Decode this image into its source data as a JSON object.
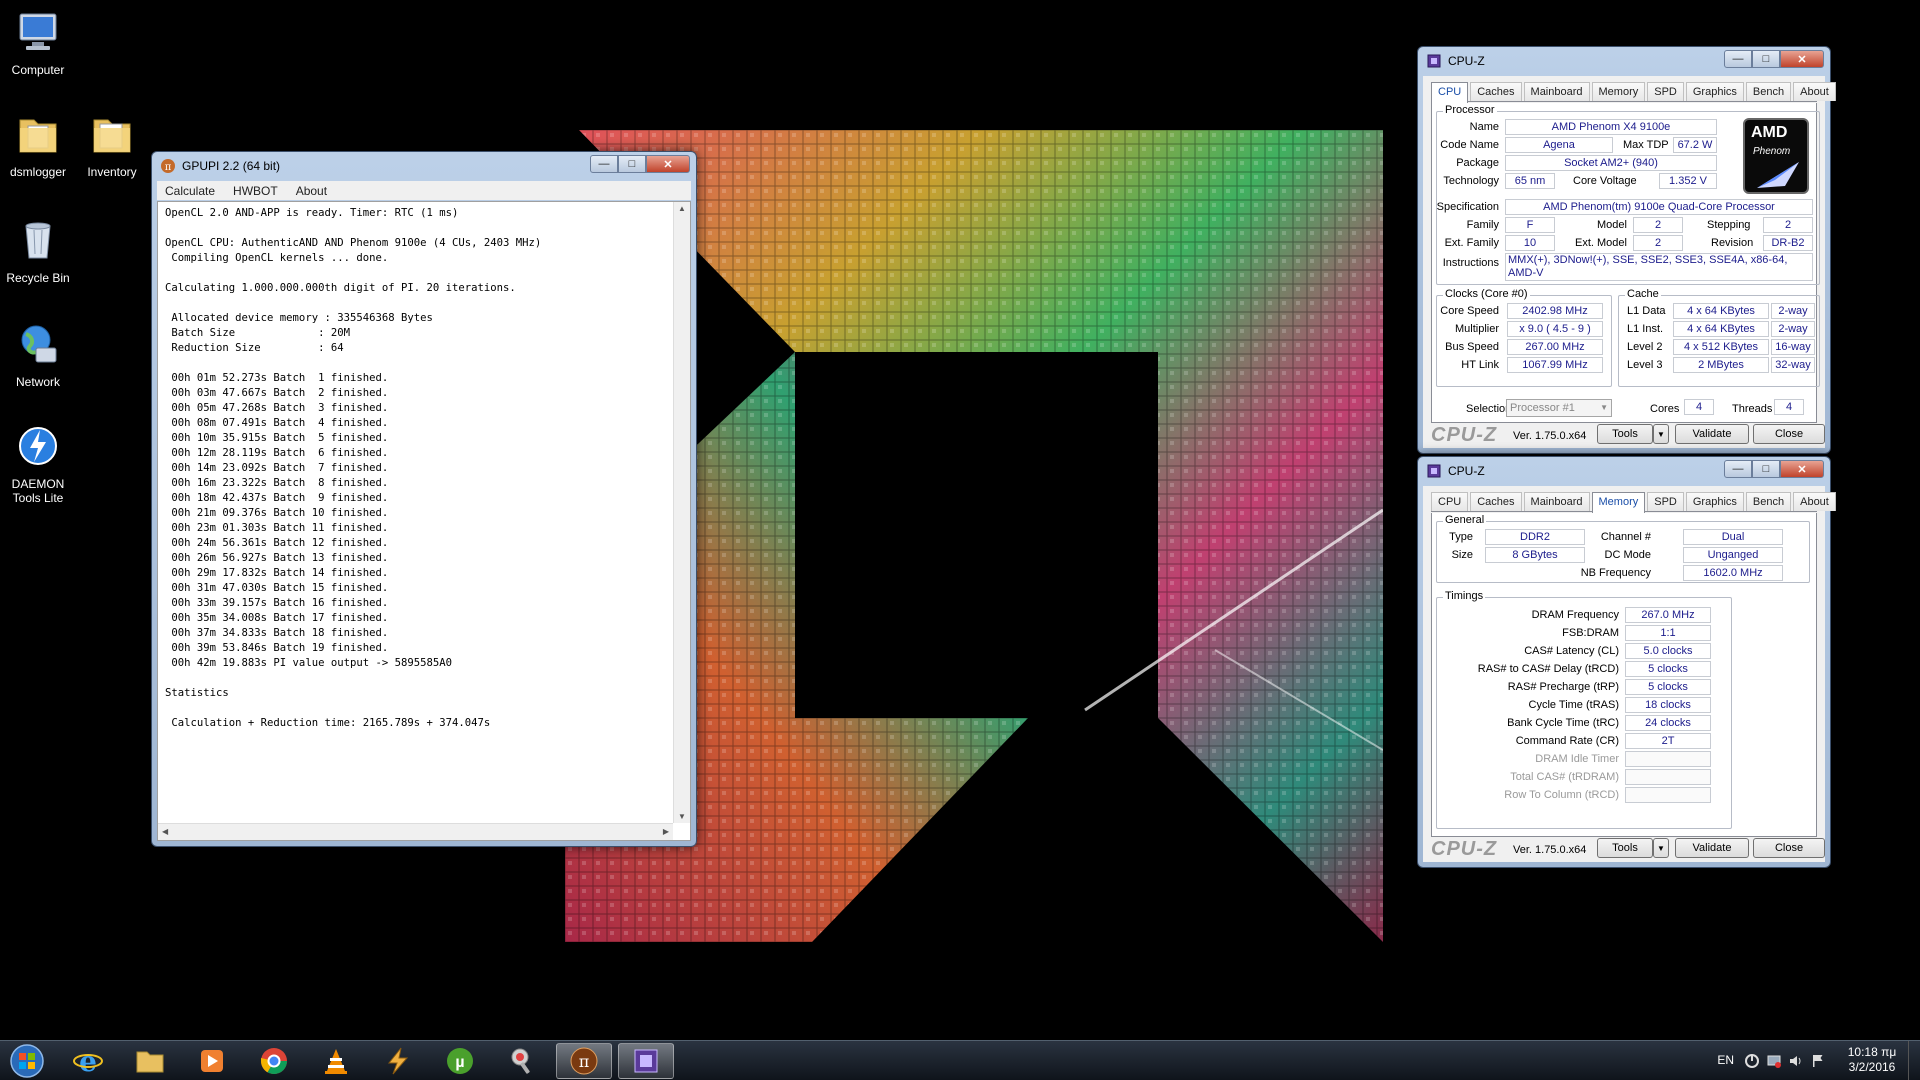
{
  "desktop": {
    "icons": [
      {
        "label": "Computer"
      },
      {
        "label": "dsmlogger"
      },
      {
        "label": "Inventory"
      },
      {
        "label": "Recycle Bin"
      },
      {
        "label": "Network"
      },
      {
        "label": "DAEMON Tools Lite"
      }
    ]
  },
  "gpupi": {
    "title": "GPUPI 2.2 (64 bit)",
    "menu": [
      "Calculate",
      "HWBOT",
      "About"
    ],
    "output": "OpenCL 2.0 AND-APP is ready. Timer: RTC (1 ms)\n\nOpenCL CPU: AuthenticAND AND Phenom 9100e (4 CUs, 2403 MHz)\n Compiling OpenCL kernels ... done.\n\nCalculating 1.000.000.000th digit of PI. 20 iterations.\n\n Allocated device memory : 335546368 Bytes\n Batch Size             : 20M\n Reduction Size         : 64\n\n 00h 01m 52.273s Batch  1 finished.\n 00h 03m 47.667s Batch  2 finished.\n 00h 05m 47.268s Batch  3 finished.\n 00h 08m 07.491s Batch  4 finished.\n 00h 10m 35.915s Batch  5 finished.\n 00h 12m 28.119s Batch  6 finished.\n 00h 14m 23.092s Batch  7 finished.\n 00h 16m 23.322s Batch  8 finished.\n 00h 18m 42.437s Batch  9 finished.\n 00h 21m 09.376s Batch 10 finished.\n 00h 23m 01.303s Batch 11 finished.\n 00h 24m 56.361s Batch 12 finished.\n 00h 26m 56.927s Batch 13 finished.\n 00h 29m 17.832s Batch 14 finished.\n 00h 31m 47.030s Batch 15 finished.\n 00h 33m 39.157s Batch 16 finished.\n 00h 35m 34.008s Batch 17 finished.\n 00h 37m 34.833s Batch 18 finished.\n 00h 39m 53.846s Batch 19 finished.\n 00h 42m 19.883s PI value output -> 5895585A0\n\nStatistics\n\n Calculation + Reduction time: 2165.789s + 374.047s"
  },
  "cpuz_common": {
    "title": "CPU-Z",
    "tabs": [
      "CPU",
      "Caches",
      "Mainboard",
      "Memory",
      "SPD",
      "Graphics",
      "Bench",
      "About"
    ],
    "brand": "CPU-Z",
    "version": "Ver. 1.75.0.x64",
    "tools_label": "Tools",
    "validate_label": "Validate",
    "close_label": "Close"
  },
  "cpuz_cpu": {
    "processor_group": "Processor",
    "labels": {
      "name": "Name",
      "code_name": "Code Name",
      "max_tdp": "Max TDP",
      "package": "Package",
      "technology": "Technology",
      "core_voltage": "Core Voltage",
      "specification": "Specification",
      "family": "Family",
      "model": "Model",
      "stepping": "Stepping",
      "ext_family": "Ext. Family",
      "ext_model": "Ext. Model",
      "revision": "Revision",
      "instructions": "Instructions"
    },
    "name": "AMD Phenom X4 9100e",
    "code_name": "Agena",
    "max_tdp": "67.2 W",
    "package": "Socket AM2+ (940)",
    "technology": "65 nm",
    "core_voltage": "1.352 V",
    "specification": "AMD Phenom(tm) 9100e Quad-Core Processor",
    "family": "F",
    "model": "2",
    "stepping": "2",
    "ext_family": "10",
    "ext_model": "2",
    "revision": "DR-B2",
    "instructions_line1": "MMX(+), 3DNow!(+), SSE, SSE2, SSE3, SSE4A, x86-64,",
    "instructions_line2": "AMD-V",
    "badge_amd": "AMD",
    "badge_phenom": "Phenom",
    "clocks_group": "Clocks (Core #0)",
    "clock_labels": {
      "core_speed": "Core Speed",
      "multiplier": "Multiplier",
      "bus_speed": "Bus Speed",
      "ht_link": "HT Link"
    },
    "core_speed": "2402.98 MHz",
    "multiplier": "x 9.0 ( 4.5 - 9 )",
    "bus_speed": "267.00 MHz",
    "ht_link": "1067.99 MHz",
    "cache_group": "Cache",
    "cache_rows": [
      {
        "label": "L1 Data",
        "size": "4 x 64 KBytes",
        "way": "2-way"
      },
      {
        "label": "L1 Inst.",
        "size": "4 x 64 KBytes",
        "way": "2-way"
      },
      {
        "label": "Level 2",
        "size": "4 x 512 KBytes",
        "way": "16-way"
      },
      {
        "label": "Level 3",
        "size": "2 MBytes",
        "way": "32-way"
      }
    ],
    "selection_label": "Selection",
    "selection_value": "Processor #1",
    "cores_label": "Cores",
    "cores": "4",
    "threads_label": "Threads",
    "threads": "4"
  },
  "cpuz_mem": {
    "general_group": "General",
    "type_label": "Type",
    "type": "DDR2",
    "size_label": "Size",
    "size": "8 GBytes",
    "channel_label": "Channel #",
    "channel": "Dual",
    "dc_mode_label": "DC Mode",
    "dc_mode": "Unganged",
    "nb_freq_label": "NB Frequency",
    "nb_freq": "1602.0 MHz",
    "timings_group": "Timings",
    "timings": [
      {
        "label": "DRAM Frequency",
        "value": "267.0 MHz"
      },
      {
        "label": "FSB:DRAM",
        "value": "1:1"
      },
      {
        "label": "CAS# Latency (CL)",
        "value": "5.0 clocks"
      },
      {
        "label": "RAS# to CAS# Delay (tRCD)",
        "value": "5 clocks"
      },
      {
        "label": "RAS# Precharge (tRP)",
        "value": "5 clocks"
      },
      {
        "label": "Cycle Time (tRAS)",
        "value": "18 clocks"
      },
      {
        "label": "Bank Cycle Time (tRC)",
        "value": "24 clocks"
      },
      {
        "label": "Command Rate (CR)",
        "value": "2T"
      },
      {
        "label": "DRAM Idle Timer",
        "value": ""
      },
      {
        "label": "Total CAS# (tRDRAM)",
        "value": ""
      },
      {
        "label": "Row To Column (tRCD)",
        "value": ""
      }
    ]
  },
  "taskbar": {
    "lang": "EN",
    "time": "10:18 πμ",
    "date": "3/2/2016"
  }
}
